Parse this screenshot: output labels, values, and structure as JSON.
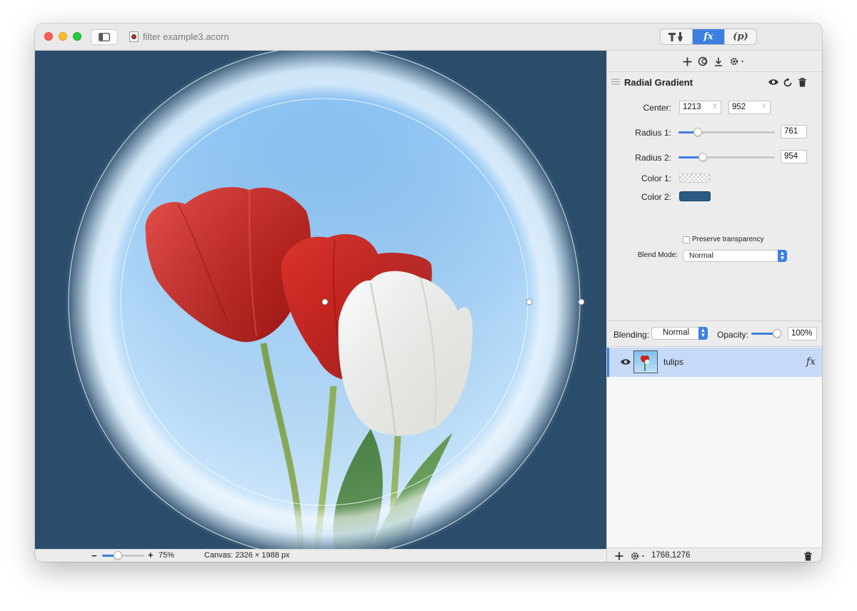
{
  "window": {
    "document_title": "filter example3.acorn"
  },
  "toolbar": {
    "segments": [
      {
        "name": "tools",
        "glyph": "T🖌",
        "active": false
      },
      {
        "name": "filters",
        "glyph": "fx",
        "active": true
      },
      {
        "name": "properties",
        "glyph": "(p)",
        "active": false
      }
    ]
  },
  "filter_toolbar": {
    "icons": [
      "plus-icon",
      "filter-stack-icon",
      "download-icon",
      "gear-menu-icon"
    ]
  },
  "filter": {
    "name": "Radial Gradient",
    "center_label": "Center:",
    "center_x": "1213",
    "center_x_suffix": "X",
    "center_y": "952",
    "center_y_suffix": "Y",
    "radius1_label": "Radius 1:",
    "radius1_value": "761",
    "radius1_fraction": 0.2,
    "radius2_label": "Radius 2:",
    "radius2_value": "954",
    "radius2_fraction": 0.25,
    "color1_label": "Color 1:",
    "color1": "transparent",
    "color2_label": "Color 2:",
    "color2": "#2b5a82",
    "preserve_label": "Preserve transparency",
    "preserve_checked": false,
    "blend_label": "Blend Mode:",
    "blend_value": "Normal"
  },
  "layer_controls": {
    "blending_label": "Blending:",
    "blending_value": "Normal",
    "opacity_label": "Opacity:",
    "opacity_value": "100%",
    "opacity_fraction": 1.0
  },
  "layers": [
    {
      "name": "tulips",
      "visible": true,
      "selected": true,
      "has_filter": true,
      "fx_glyph": "fx"
    }
  ],
  "layers_footer": {
    "coords": "1768,1276"
  },
  "status": {
    "zoom_minus": "−",
    "zoom_plus": "+",
    "zoom_fraction": 0.38,
    "zoom": "75%",
    "canvas_info": "Canvas: 2326 × 1988 px"
  },
  "colors": {
    "accent": "#3d7fe0",
    "canvas_background": "#2b4d6b",
    "selected_row": "#c6d9f7"
  }
}
